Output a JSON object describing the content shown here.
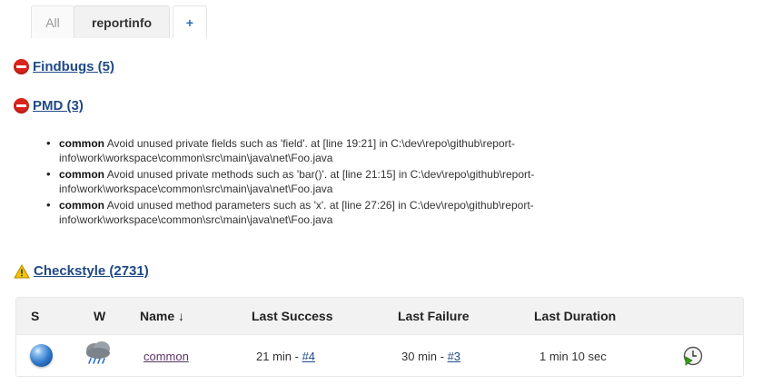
{
  "tabs": [
    {
      "label": "All"
    },
    {
      "label": "reportinfo"
    },
    {
      "label": "+"
    }
  ],
  "sections": {
    "findbugs": {
      "title": "Findbugs (5)"
    },
    "pmd": {
      "title": "PMD (3)"
    },
    "checkstyle": {
      "title": "Checkstyle (2731)"
    }
  },
  "pmd_items": [
    {
      "module": "common",
      "text": " Avoid unused private fields such as 'field'. at [line 19:21] in C:\\dev\\repo\\github\\report-info\\work\\workspace\\common\\src\\main\\java\\net\\Foo.java"
    },
    {
      "module": "common",
      "text": " Avoid unused private methods such as 'bar()'. at [line 21:15] in C:\\dev\\repo\\github\\report-info\\work\\workspace\\common\\src\\main\\java\\net\\Foo.java"
    },
    {
      "module": "common",
      "text": " Avoid unused method parameters such as 'x'. at [line 27:26] in C:\\dev\\repo\\github\\report-info\\work\\workspace\\common\\src\\main\\java\\net\\Foo.java"
    }
  ],
  "table": {
    "headers": {
      "s": "S",
      "w": "W",
      "name": "Name ↓",
      "last_success": "Last Success",
      "last_failure": "Last Failure",
      "last_duration": "Last Duration"
    },
    "row": {
      "status_icon": "blue-ball-icon",
      "weather_icon": "rain-cloud-icon",
      "name": "common",
      "success_time": "21 min - ",
      "success_build": "#4",
      "failure_time": "30 min - ",
      "failure_build": "#3",
      "duration": "1 min 10 sec",
      "action_icon": "schedule-build-icon"
    }
  },
  "colors": {
    "link": "#204a87",
    "error": "#d9241c",
    "warning": "#f5c400",
    "visited": "#5c3566"
  }
}
